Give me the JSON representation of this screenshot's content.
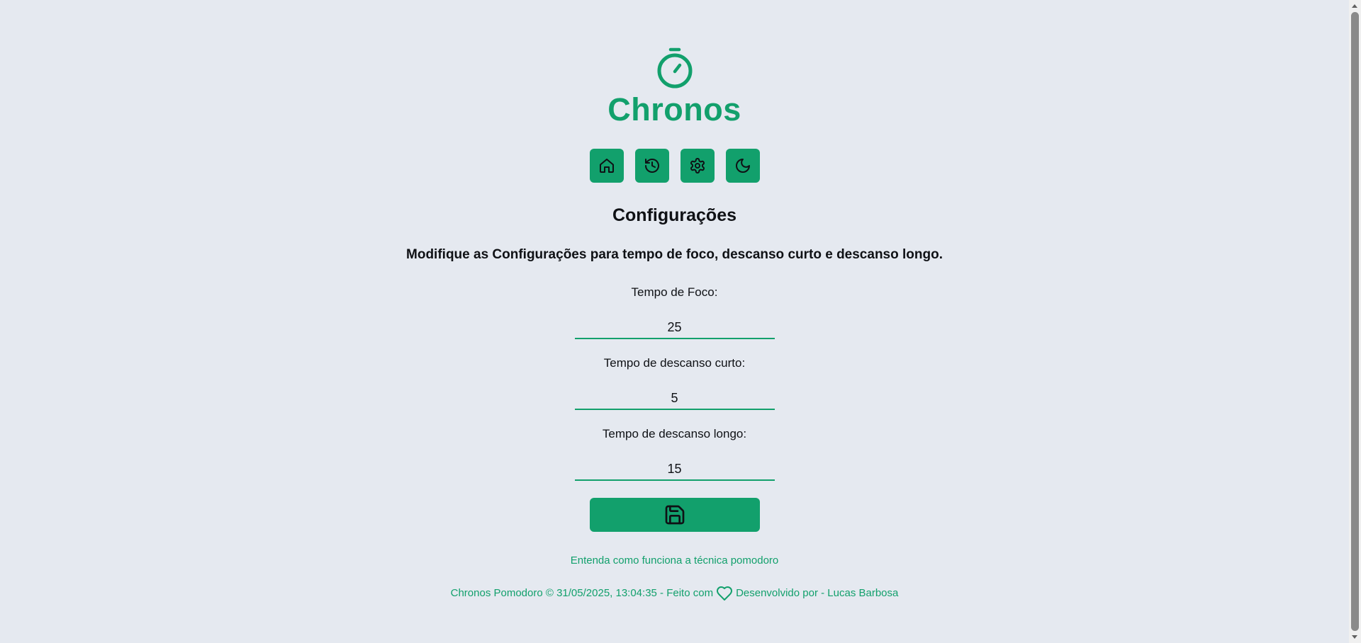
{
  "app": {
    "title": "Chronos",
    "logo_icon": "stopwatch-icon",
    "accent_color": "#12a06c",
    "background_color": "#e5e9f0"
  },
  "nav": {
    "items": [
      {
        "name": "home",
        "icon": "home-icon"
      },
      {
        "name": "history",
        "icon": "history-icon"
      },
      {
        "name": "settings",
        "icon": "gear-icon"
      },
      {
        "name": "theme",
        "icon": "moon-icon"
      }
    ]
  },
  "settings": {
    "heading": "Configurações",
    "subtitle": "Modifique as Configurações para tempo de foco, descanso curto e descanso longo.",
    "fields": [
      {
        "label": "Tempo de Foco:",
        "value": "25"
      },
      {
        "label": "Tempo de descanso curto:",
        "value": "5"
      },
      {
        "label": "Tempo de descanso longo:",
        "value": "15"
      }
    ],
    "save_icon": "save-icon"
  },
  "links": {
    "learn": "Entenda como funciona a técnica pomodoro"
  },
  "footer": {
    "left_text": "Chronos Pomodoro © 31/05/2025, 13:04:35 - Feito com",
    "heart_icon": "heart-icon",
    "right_text": "Desenvolvido por - Lucas Barbosa"
  }
}
